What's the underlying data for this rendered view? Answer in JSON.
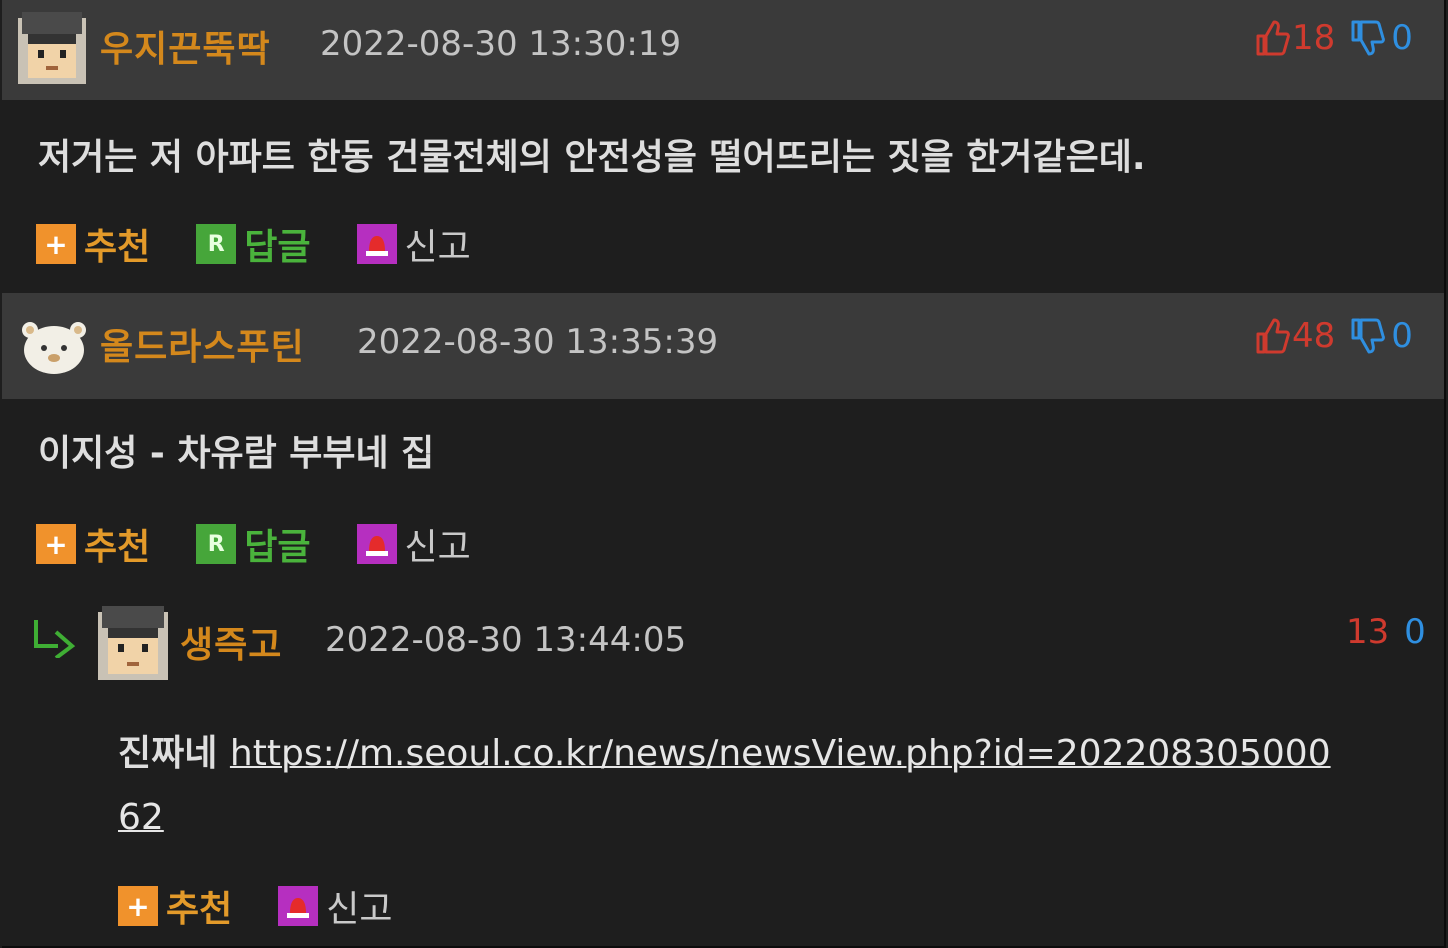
{
  "comments": [
    {
      "username": "우지끈뚝딱",
      "datetime": "2022-08-30 13:30:19",
      "upvotes": "18",
      "downvotes": "0",
      "text": "저거는 저 아파트 한동 건물전체의 안전성을 떨어뜨리는 짓을 한거같은데.",
      "actions": {
        "recommend": "추천",
        "reply": "답글",
        "report": "신고"
      }
    },
    {
      "username": "올드라스푸틴",
      "datetime": "2022-08-30 13:35:39",
      "upvotes": "48",
      "downvotes": "0",
      "text": "이지성 - 차유람 부부네 집",
      "actions": {
        "recommend": "추천",
        "reply": "답글",
        "report": "신고"
      },
      "reply": {
        "username": "생즉고",
        "datetime": "2022-08-30 13:44:05",
        "upvotes": "13",
        "downvotes": "0",
        "text_prefix": "진짜네",
        "link_line1": "https://m.seoul.co.kr/news/newsView.php?id=202208305000",
        "link_line2": "62",
        "actions": {
          "recommend": "추천",
          "report": "신고"
        }
      }
    }
  ],
  "icons": {
    "upvote": "thumbs-up-icon",
    "downvote": "thumbs-down-icon",
    "recommend": "plus-icon",
    "reply": "reply-r-icon",
    "report": "siren-icon",
    "reply_indicator": "reply-arrow-icon"
  },
  "colors": {
    "username": "#d4881c",
    "upvote": "#cf3a2e",
    "downvote": "#2f8fe0",
    "header_bg": "#3a3a3a",
    "body_bg": "#1e1e1e"
  }
}
